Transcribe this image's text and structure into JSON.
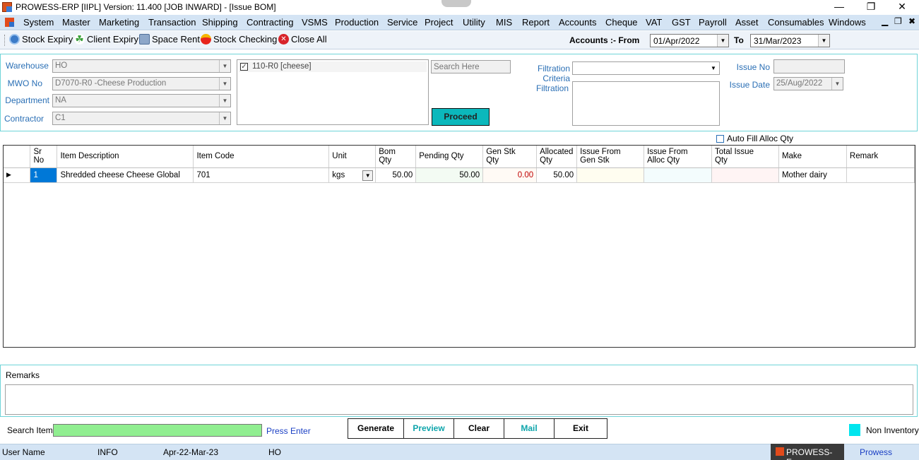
{
  "window": {
    "title": "PROWESS-ERP [IIPL]  Version: 11.400 [JOB INWARD] - [Issue BOM]"
  },
  "menu": [
    "System",
    "Master",
    "Marketing",
    "Transaction",
    "Shipping",
    "Contracting",
    "VSMS",
    "Production",
    "Service",
    "Project",
    "Utility",
    "MIS",
    "Report",
    "Accounts",
    "Cheque",
    "VAT",
    "GST",
    "Payroll",
    "Asset",
    "Consumables",
    "Windows"
  ],
  "toolbar": {
    "stock_expiry": "Stock Expiry",
    "client_expiry": "Client Expiry",
    "space_rent": "Space Rent",
    "stock_checking": "Stock Checking",
    "close_all": "Close All",
    "accounts_from_label": "Accounts :- From",
    "from_date": "01/Apr/2022",
    "to_label": "To",
    "to_date": "31/Mar/2023"
  },
  "form": {
    "warehouse_label": "Warehouse",
    "warehouse_value": "HO",
    "mwo_label": "MWO No",
    "mwo_value": "D7070-R0 -Cheese Production",
    "department_label": "Department",
    "department_value": "NA",
    "contractor_label": "Contractor",
    "contractor_value": "C1",
    "list_item": "110-R0 [cheese]",
    "search_placeholder": "Search Here",
    "proceed_label": "Proceed",
    "filtration_criteria_label": "Filtration Criteria",
    "filtration_criteria_value": "",
    "filtration_label": "Filtration",
    "issue_no_label": "Issue No",
    "issue_no_value": "",
    "issue_date_label": "Issue Date",
    "issue_date_value": "25/Aug/2022",
    "auto_fill_label": "Auto Fill Alloc Qty"
  },
  "grid": {
    "headers": {
      "sr_no": "Sr No",
      "item_description": "Item Description",
      "item_code": "Item Code",
      "unit": "Unit",
      "bom_qty_1": "Bom",
      "bom_qty_2": "Qty",
      "pending_qty": "Pending Qty",
      "gen_stk_1": "Gen Stk",
      "gen_stk_2": "Qty",
      "allocated_1": "Allocated",
      "allocated_2": "Qty",
      "issue_gen_1": "Issue From",
      "issue_gen_2": "Gen Stk",
      "issue_alloc_1": "Issue From",
      "issue_alloc_2": "Alloc Qty",
      "total_issue_1": "Total Issue",
      "total_issue_2": "Qty",
      "make": "Make",
      "remark": "Remark"
    },
    "rows": [
      {
        "sr_no": "1",
        "item_description": "Shredded cheese Cheese Global",
        "item_code": "701",
        "unit": "kgs",
        "bom_qty": "50.00",
        "pending_qty": "50.00",
        "gen_stk_qty": "0.00",
        "allocated_qty": "50.00",
        "issue_from_gen_stk": "",
        "issue_from_alloc_qty": "",
        "total_issue_qty": "",
        "make": "Mother dairy",
        "remark": ""
      }
    ]
  },
  "remarks": {
    "label": "Remarks",
    "value": ""
  },
  "bottom": {
    "search_item_label": "Search Item",
    "search_item_value": "",
    "press_enter": "Press Enter",
    "generate": "Generate",
    "preview": "Preview",
    "clear": "Clear",
    "mail": "Mail",
    "exit": "Exit",
    "non_inventory": "Non Inventory"
  },
  "status": {
    "user_name_label": "User Name",
    "user": "INFO",
    "period": "Apr-22-Mar-23",
    "branch": "HO",
    "taskbar_item": "PROWESS-E...",
    "taskbar_right": "Prowess"
  },
  "colors": {
    "accent_teal": "#0bb8bc",
    "search_green": "#90ee90",
    "menu_bg": "#d4e4f4",
    "panel_border": "#6fd4d8",
    "non_inventory": "#00e5ee"
  }
}
